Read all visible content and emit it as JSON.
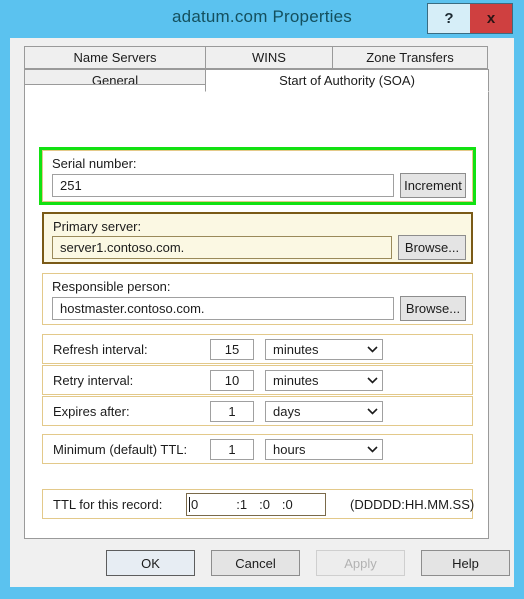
{
  "window": {
    "title": "adatum.com Properties",
    "help_caption": "?",
    "close_caption": "x",
    "frame_color": "#5bc2ef",
    "title_color": "#14505e",
    "close_color": "#cf4040"
  },
  "tabs": {
    "top_row": [
      {
        "label": "Name Servers",
        "active": false
      },
      {
        "label": "WINS",
        "active": false
      },
      {
        "label": "Zone Transfers",
        "active": false
      }
    ],
    "bottom_row": [
      {
        "label": "General",
        "active": false
      },
      {
        "label": "Start of Authority (SOA)",
        "active": true
      }
    ]
  },
  "highlight": {
    "target": "serial-number-group",
    "color": "#12e112"
  },
  "serial_number": {
    "label": "Serial number:",
    "value": "251",
    "placeholder": "",
    "button_label": "Increment"
  },
  "primary_server": {
    "label": "Primary server:",
    "value": "server1.contoso.com.",
    "placeholder": "",
    "button_label": "Browse...",
    "border_color": "#7a5a17",
    "fill_color": "#fbf8e3"
  },
  "responsible_person": {
    "label": "Responsible person:",
    "value": "hostmaster.contoso.com.",
    "placeholder": "",
    "button_label": "Browse..."
  },
  "intervals": [
    {
      "label": "Refresh interval:",
      "value": "15",
      "unit": "minutes"
    },
    {
      "label": "Retry interval:",
      "value": "10",
      "unit": "minutes"
    },
    {
      "label": "Expires after:",
      "value": "1",
      "unit": "days"
    },
    {
      "label": "Minimum (default) TTL:",
      "value": "1",
      "unit": "hours"
    }
  ],
  "ttl_record": {
    "label": "TTL for this record:",
    "days": "0",
    "hours": ":1",
    "minutes": ":0",
    "seconds": ":0",
    "format_hint": "(DDDDD:HH.MM.SS)"
  },
  "buttons": {
    "ok": "OK",
    "cancel": "Cancel",
    "apply": "Apply",
    "help": "Help",
    "apply_enabled": false
  }
}
